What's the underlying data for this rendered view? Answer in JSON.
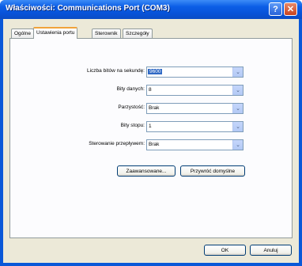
{
  "window": {
    "title": "Właściwości: Communications Port (COM3)",
    "help_label": "?",
    "close_label": "✕"
  },
  "tabs": [
    {
      "label": "Ogólne",
      "active": false
    },
    {
      "label": "Ustawienia portu",
      "active": true
    },
    {
      "label": "Sterownik",
      "active": false
    },
    {
      "label": "Szczegóły",
      "active": false
    }
  ],
  "fields": [
    {
      "label": "Liczba bitów na sekundę:",
      "value": "9600",
      "selected": true
    },
    {
      "label": "Bity danych:",
      "value": "8",
      "selected": false
    },
    {
      "label": "Parzystość:",
      "value": "Brak",
      "selected": false
    },
    {
      "label": "Bity stopu:",
      "value": "1",
      "selected": false
    },
    {
      "label": "Sterowanie przepływem:",
      "value": "Brak",
      "selected": false
    }
  ],
  "buttons": {
    "advanced": "Zaawansowane...",
    "restore_defaults": "Przywróć domyślne",
    "ok": "OK",
    "cancel": "Anuluj"
  },
  "icons": {
    "combo_arrow": "chevron-down-icon"
  },
  "colors": {
    "title_bar": "#0a58d8",
    "dialog_face": "#ece9d8",
    "selection": "#316ac5",
    "tab_highlight": "#f1a33a"
  }
}
